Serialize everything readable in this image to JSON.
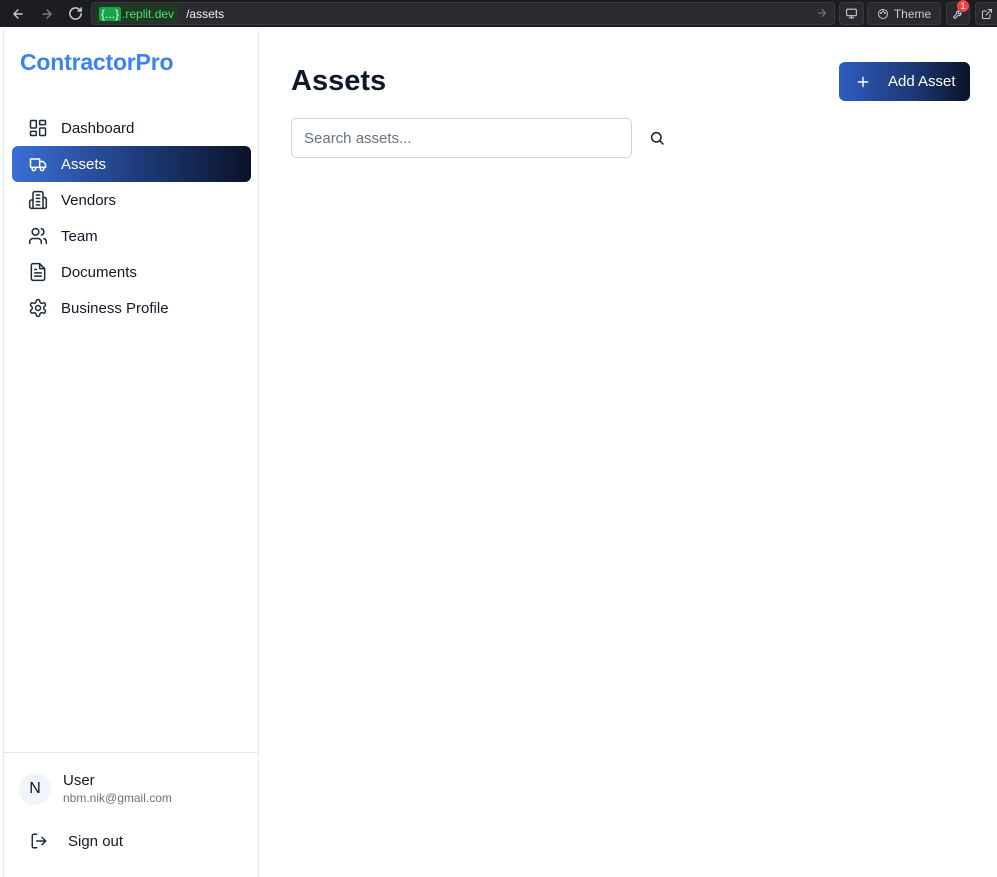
{
  "browser": {
    "domain_prefix": "{...}",
    "domain_host": ".replit.dev",
    "path": "/assets",
    "theme_label": "Theme",
    "badge_count": "1"
  },
  "sidebar": {
    "brand": "ContractorPro",
    "items": [
      {
        "label": "Dashboard",
        "icon": "dashboard-icon",
        "active": false
      },
      {
        "label": "Assets",
        "icon": "truck-icon",
        "active": true
      },
      {
        "label": "Vendors",
        "icon": "building-icon",
        "active": false
      },
      {
        "label": "Team",
        "icon": "users-icon",
        "active": false
      },
      {
        "label": "Documents",
        "icon": "document-icon",
        "active": false
      },
      {
        "label": "Business Profile",
        "icon": "gear-icon",
        "active": false
      }
    ],
    "user": {
      "initial": "N",
      "name": "User",
      "email": "nbm.nik@gmail.com"
    },
    "signout_label": "Sign out"
  },
  "main": {
    "title": "Assets",
    "add_button_label": "Add Asset",
    "search": {
      "placeholder": "Search assets...",
      "value": ""
    }
  },
  "colors": {
    "brand": "#3b82f6",
    "accent_start": "#3b6fd4",
    "accent_end": "#0b1228"
  }
}
